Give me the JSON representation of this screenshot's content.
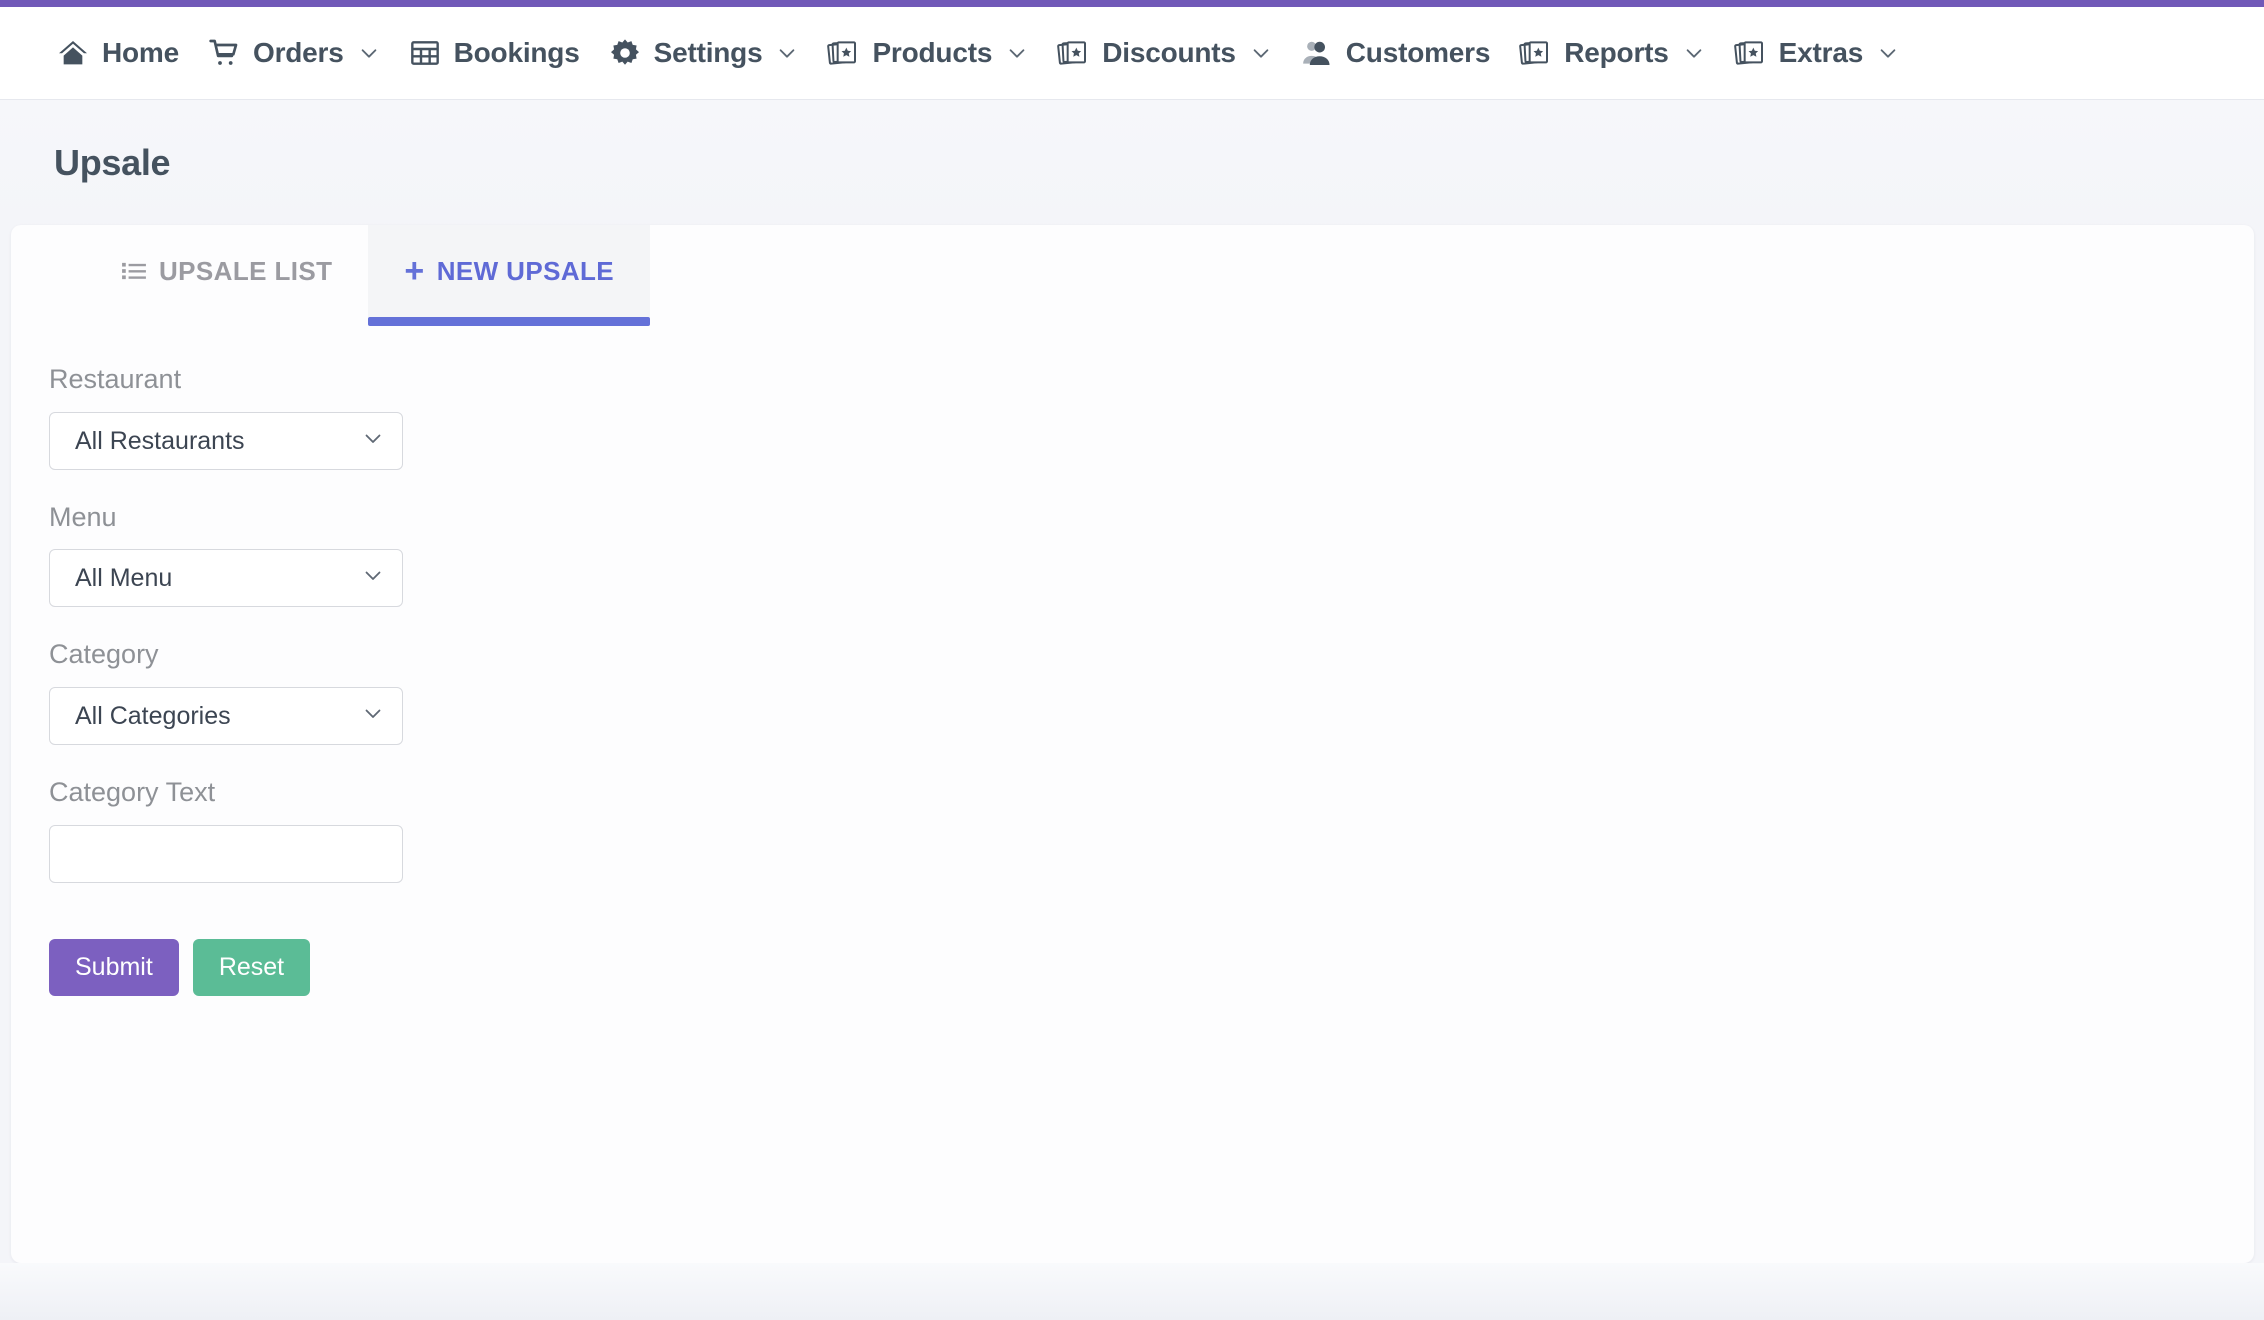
{
  "theme": {
    "accent_bar_color": "#7159b8",
    "tab_active_color": "#6471d8",
    "submit_color": "#7c60c0",
    "reset_color": "#5bbc96",
    "nav_text_color": "#45525f"
  },
  "navbar": {
    "items": [
      {
        "label": "Home",
        "icon": "home-icon",
        "caret": false
      },
      {
        "label": "Orders",
        "icon": "cart-icon",
        "caret": true
      },
      {
        "label": "Bookings",
        "icon": "table-icon",
        "caret": false
      },
      {
        "label": "Settings",
        "icon": "gear-icon",
        "caret": true
      },
      {
        "label": "Products",
        "icon": "cards-icon",
        "caret": true
      },
      {
        "label": "Discounts",
        "icon": "cards-icon",
        "caret": true
      },
      {
        "label": "Customers",
        "icon": "user-icon",
        "caret": false
      },
      {
        "label": "Reports",
        "icon": "cards-icon",
        "caret": true
      },
      {
        "label": "Extras",
        "icon": "cards-icon",
        "caret": true
      }
    ]
  },
  "header": {
    "title": "Upsale"
  },
  "tabs": [
    {
      "label": "UPSALE LIST",
      "icon": "list-icon",
      "active": false
    },
    {
      "label": "NEW UPSALE",
      "icon": "plus-icon",
      "active": true
    }
  ],
  "form": {
    "fields": [
      {
        "label": "Restaurant",
        "type": "select",
        "value": "All Restaurants",
        "options": [
          "All Restaurants"
        ]
      },
      {
        "label": "Menu",
        "type": "select",
        "value": "All Menu",
        "options": [
          "All Menu"
        ]
      },
      {
        "label": "Category",
        "type": "select",
        "value": "All Categories",
        "options": [
          "All Categories"
        ]
      },
      {
        "label": "Category Text",
        "type": "text",
        "value": "",
        "placeholder": ""
      }
    ],
    "submit_label": "Submit",
    "reset_label": "Reset"
  }
}
